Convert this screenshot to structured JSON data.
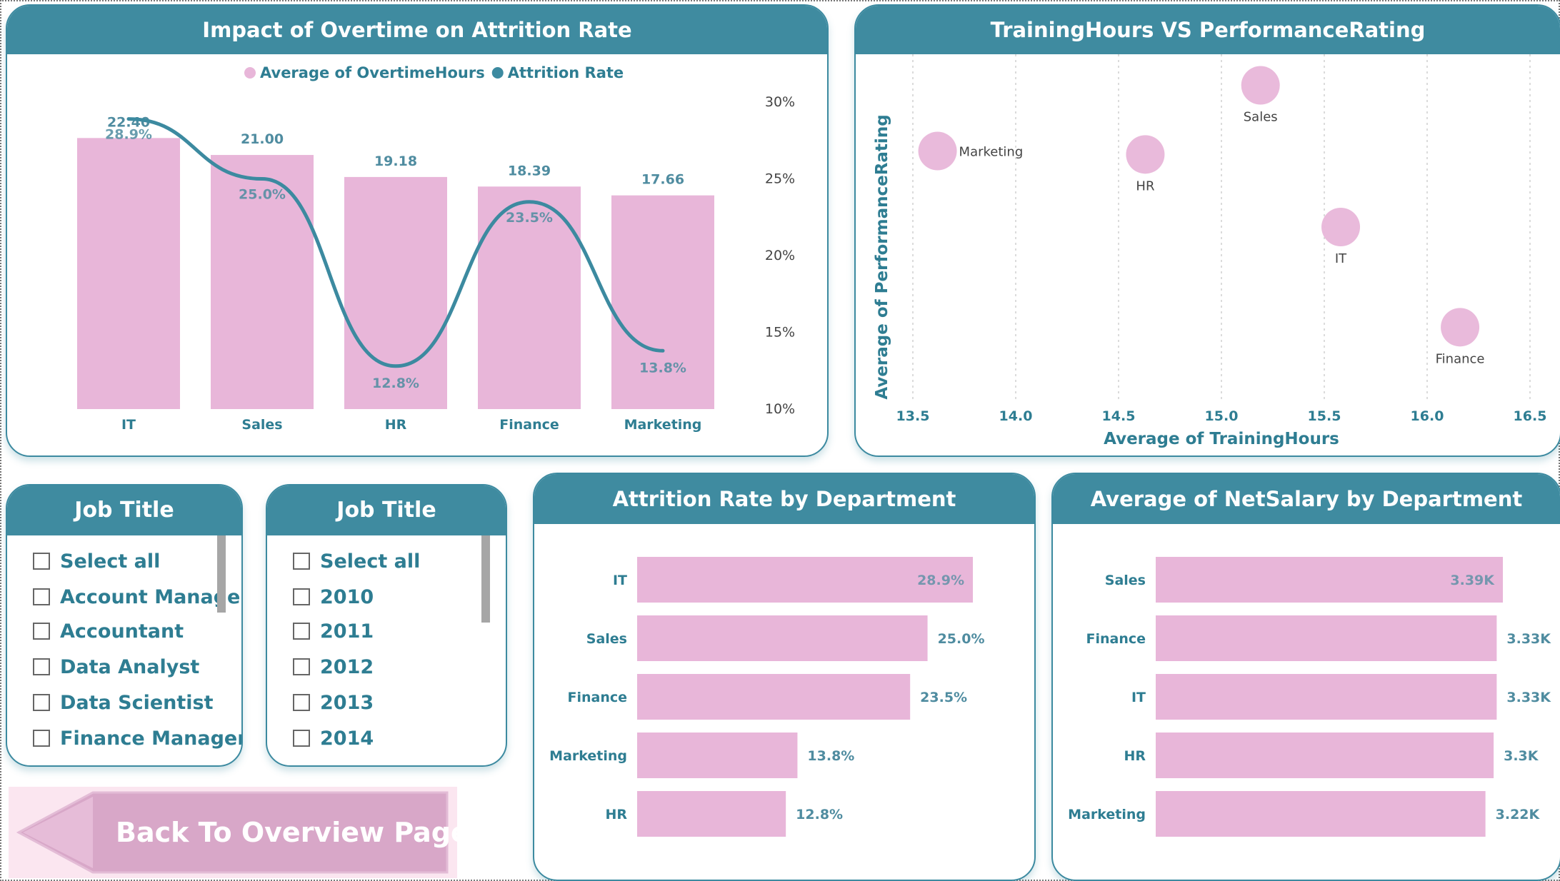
{
  "colors": {
    "header": "#3f8ba0",
    "bar": "#e8b6d9",
    "line": "#3c8aa0",
    "label": "#2e7d92",
    "value_label": "#4f8ca0"
  },
  "back_button": {
    "label": "Back To Overview Page"
  },
  "slicers": [
    {
      "title": "Job Title",
      "items": [
        "Select all",
        "Account Manage",
        "Accountant",
        "Data Analyst",
        "Data Scientist",
        "Finance Manager"
      ]
    },
    {
      "title": "Job Title",
      "items": [
        "Select all",
        "2010",
        "2011",
        "2012",
        "2013",
        "2014"
      ]
    }
  ],
  "chart_data": [
    {
      "id": "overtime",
      "type": "bar",
      "title": "Impact of Overtime on Attrition Rate",
      "categories": [
        "IT",
        "Sales",
        "HR",
        "Finance",
        "Marketing"
      ],
      "series": [
        {
          "name": "Average of OvertimeHours",
          "type": "bar",
          "values": [
            22.4,
            21.0,
            19.18,
            18.39,
            17.66
          ],
          "labels": [
            "22.40",
            "21.00",
            "19.18",
            "18.39",
            "17.66"
          ]
        },
        {
          "name": "Attrition Rate",
          "type": "line",
          "values": [
            28.9,
            25.0,
            12.8,
            23.5,
            13.8
          ],
          "labels": [
            "28.9%",
            "25.0%",
            "12.8%",
            "23.5%",
            "13.8%"
          ]
        }
      ],
      "y2_ticks": [
        "30%",
        "25%",
        "20%",
        "15%",
        "10%"
      ],
      "y2lim": [
        10,
        30
      ],
      "legend": "top-center",
      "grid": false
    },
    {
      "id": "training",
      "type": "scatter",
      "title": "TrainingHours VS PerformanceRating",
      "xlabel": "Average of TrainingHours",
      "ylabel": "Average of PerformanceRating",
      "xlim": [
        13.5,
        16.5
      ],
      "x_ticks": [
        "13.5",
        "14.0",
        "14.5",
        "15.0",
        "15.5",
        "16.0",
        "16.5"
      ],
      "ylim": [
        0,
        10
      ],
      "points": [
        {
          "label": "Sales",
          "x": 15.19,
          "y": 9.1
        },
        {
          "label": "Marketing",
          "x": 13.62,
          "y": 7.2
        },
        {
          "label": "HR",
          "x": 14.63,
          "y": 7.1
        },
        {
          "label": "IT",
          "x": 15.58,
          "y": 5.0
        },
        {
          "label": "Finance",
          "x": 16.16,
          "y": 2.1
        }
      ],
      "grid": "vertical-dotted"
    },
    {
      "id": "attrition_dept",
      "type": "bar",
      "orientation": "horizontal",
      "title": "Attrition Rate by Department",
      "categories": [
        "IT",
        "Sales",
        "Finance",
        "Marketing",
        "HR"
      ],
      "values": [
        28.9,
        25.0,
        23.5,
        13.8,
        12.8
      ],
      "labels": [
        "28.9%",
        "25.0%",
        "23.5%",
        "13.8%",
        "12.8%"
      ]
    },
    {
      "id": "salary_dept",
      "type": "bar",
      "orientation": "horizontal",
      "title": "Average of NetSalary by Department",
      "categories": [
        "Sales",
        "Finance",
        "IT",
        "HR",
        "Marketing"
      ],
      "values": [
        3.39,
        3.33,
        3.33,
        3.3,
        3.22
      ],
      "labels": [
        "3.39K",
        "3.33K",
        "3.33K",
        "3.3K",
        "3.22K"
      ]
    }
  ]
}
